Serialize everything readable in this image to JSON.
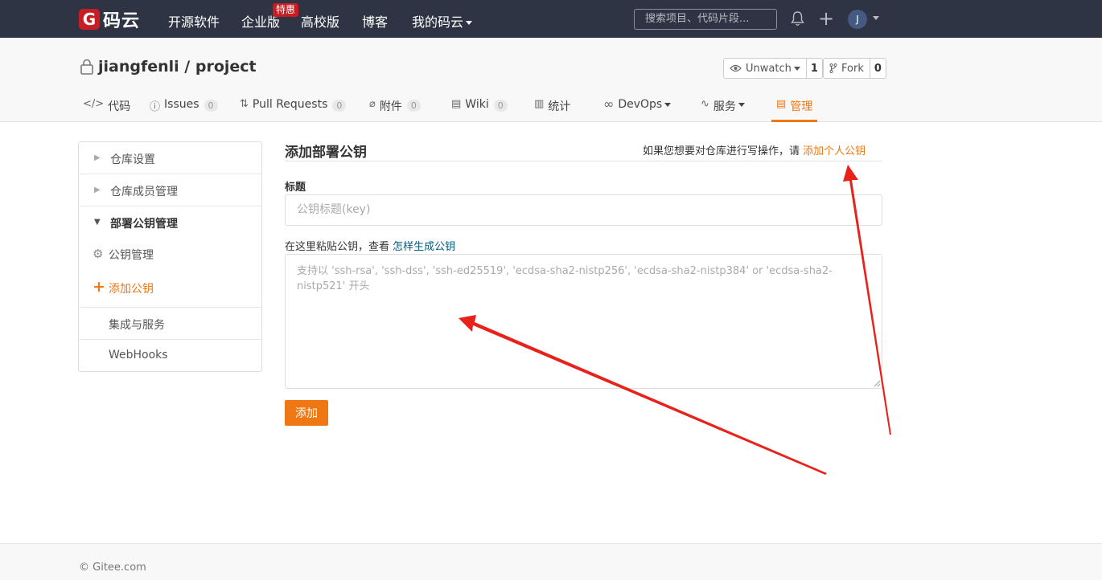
{
  "topnav": {
    "logo_mark": "G",
    "logo_text": "码云",
    "links": [
      "开源软件",
      "企业版",
      "高校版",
      "博客",
      "我的码云"
    ],
    "hot_badge": "特惠",
    "search_placeholder": "搜索项目、代码片段...",
    "avatar_letter": "J"
  },
  "repo": {
    "title": "jiangfenli / project",
    "watch_label": "Unwatch",
    "watch_count": "1",
    "fork_label": "Fork",
    "fork_count": "0"
  },
  "tabs": [
    {
      "label": "代码",
      "icon": "code-icon"
    },
    {
      "label": "Issues",
      "badge": "0",
      "icon": "issue-icon"
    },
    {
      "label": "Pull Requests",
      "badge": "0",
      "icon": "pull-request-icon"
    },
    {
      "label": "附件",
      "badge": "0",
      "icon": "paperclip-icon"
    },
    {
      "label": "Wiki",
      "badge": "0",
      "icon": "book-icon"
    },
    {
      "label": "统计",
      "icon": "bar-chart-icon"
    },
    {
      "label": "DevOps",
      "icon": "infinity-icon"
    },
    {
      "label": "服务",
      "icon": "pulse-icon"
    },
    {
      "label": "管理",
      "icon": "manage-icon",
      "active": true
    }
  ],
  "sidebar": {
    "items": [
      "仓库设置",
      "仓库成员管理",
      "部署公钥管理",
      "公钥管理",
      "添加公钥",
      "集成与服务",
      "WebHooks"
    ]
  },
  "main": {
    "title": "添加部署公钥",
    "hint_prefix": "如果您想要对仓库进行写操作，请",
    "hint_link": "添加个人公钥",
    "title_label": "标题",
    "title_placeholder": "公钥标题(key)",
    "key_label_prefix": "在这里粘贴公钥，查看",
    "key_label_link": "怎样生成公钥",
    "key_placeholder": "支持以 'ssh-rsa', 'ssh-dss', 'ssh-ed25519', 'ecdsa-sha2-nistp256', 'ecdsa-sha2-nistp384' or 'ecdsa-sha2-nistp521' 开头",
    "add_button": "添加"
  },
  "footer": {
    "copyright": "© Gitee.com"
  },
  "colors": {
    "accent": "#f07814",
    "nav_bg": "#2e3443",
    "brand_red": "#c71d23",
    "annotation_red": "#e8221b"
  }
}
